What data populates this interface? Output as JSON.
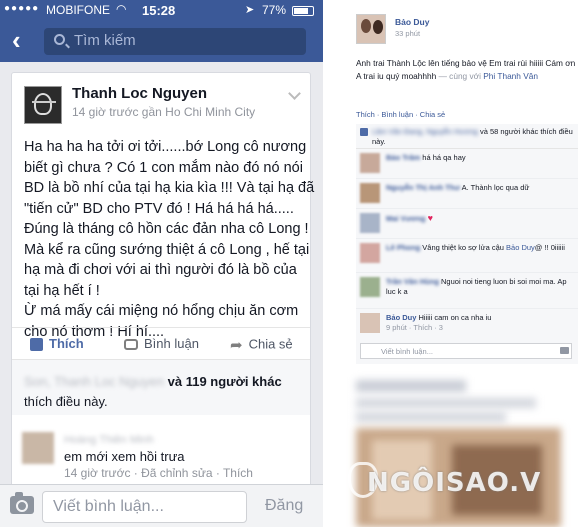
{
  "status_bar": {
    "carrier": "MOBIFONE",
    "time": "15:28",
    "battery": "77%"
  },
  "nav": {
    "search_placeholder": "Tìm kiếm"
  },
  "post": {
    "author": "Thanh Loc Nguyen",
    "meta": "14 giờ trước gần Ho Chi Minh City",
    "lines": [
      "Ha ha ha ha tởi ơi tởi......bớ Long cô nương",
      "biết gì chưa ? Có 1 con mắm nào đó nó nói",
      "BD là bồ nhí của tại hạ kia kìa !!! Và tại hạ đã",
      "\"tiến cử\" BD cho PTV đó ! Há há há há.....",
      "Đúng là tháng cô hồn các đản nha cô Long !",
      "Mà kể ra cũng sướng thiệt á cô Long , hế tại",
      "hạ mà đi chơi với ai thì người đó là bồ của",
      "tại hạ hết í !",
      "Ừ má mấy cái miệng nó hổng chịu ăn cơm",
      "cho nó thơm ! Hí hí...."
    ],
    "actions": {
      "like": "Thích",
      "comment": "Bình luận",
      "share": "Chia sẻ"
    },
    "likes": {
      "blurred_name": "Son, Thanh Loc Nguyen",
      "joiner": "và",
      "count_text": "119 người khác",
      "suffix": "thích điều này."
    },
    "comment": {
      "blurred_name": "Hoàng Thiên Minh",
      "text": "em mới xem hồi trưa",
      "meta": "14 giờ trước · Đã chỉnh sửa · Thích"
    },
    "composer": {
      "placeholder": "Viết bình luận...",
      "post_label": "Đăng"
    }
  },
  "web_post": {
    "author": "Bảo Duy",
    "time": "33 phút",
    "text_main": "Anh trai Thành Lộc lên tiếng bảo vệ Em trai rùi hiiiii Cám ơn A trai iu quý moahhhh",
    "text_with": "— cùng với",
    "text_with_name": "Phi Thanh Vân",
    "actions": "Thích · Bình luận · Chia sẻ",
    "likes_blur": "Lâm Văn Đang, Nguyễn Hương",
    "likes_tail": "và 58 người khác thích điều này.",
    "comments": [
      {
        "name": "Bảo Trâm",
        "text": "há há qa hay",
        "avatar_color": "#c7a99a"
      },
      {
        "name": "Nguyễn Thị Anh Thư",
        "text": "A. Thành lọc qua dữ",
        "avatar_color": "#b89678"
      },
      {
        "name": "Mai Vương",
        "text": "",
        "heart": "♥",
        "avatar_color": "#a8b4c8"
      },
      {
        "name": "Lê Phong",
        "text": "Vâng thiệt ko sợ lửa cậu",
        "link": "Bảo Duy",
        "tail": "@ !! 0iiiiii",
        "avatar_color": "#d3a6a0"
      },
      {
        "name": "Trần Văn Hùng",
        "text": "Nguoi noi tieng luon bi soi moi ma. Ap luc k a",
        "avatar_color": "#9bb08e"
      }
    ],
    "reply": {
      "author": "Bảo Duy",
      "text": "Hiiiii cam on ca nha iu",
      "meta": "9 phút · Thích · 3"
    },
    "comment_placeholder": "Viết bình luận..."
  },
  "watermark": {
    "text": "NGÔISAO.V"
  }
}
